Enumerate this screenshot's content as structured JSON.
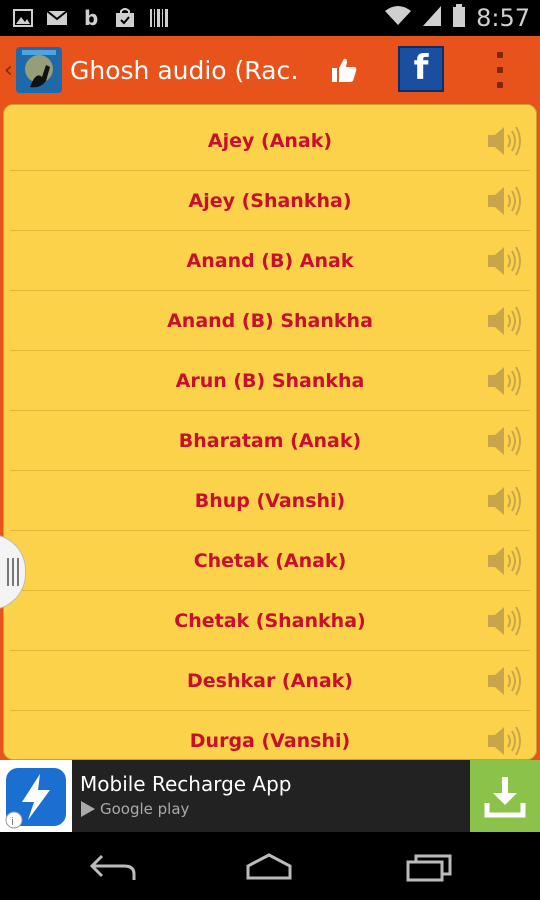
{
  "status_bar": {
    "time": "8:57",
    "left_icons": [
      "gallery-icon",
      "gmail-icon",
      "b-app-icon",
      "shopping-bag-icon",
      "barcode-icon"
    ],
    "right_icons": [
      "wifi-icon",
      "signal-icon",
      "battery-icon"
    ]
  },
  "action_bar": {
    "title": "Ghosh audio (Rac…",
    "like_icon": "thumbs-up-icon",
    "facebook_label": "f",
    "overflow_icon": "overflow-menu-icon"
  },
  "list": {
    "items": [
      {
        "label": "Ajey (Anak)"
      },
      {
        "label": "Ajey (Shankha)"
      },
      {
        "label": "Anand (B) Anak"
      },
      {
        "label": "Anand (B) Shankha"
      },
      {
        "label": "Arun (B) Shankha"
      },
      {
        "label": "Bharatam (Anak)"
      },
      {
        "label": "Bhup (Vanshi)"
      },
      {
        "label": "Chetak (Anak)"
      },
      {
        "label": "Chetak (Shankha)"
      },
      {
        "label": "Deshkar (Anak)"
      },
      {
        "label": "Durga (Vanshi)"
      }
    ],
    "item_icon": "speaker-icon"
  },
  "ad": {
    "title": "Mobile Recharge App",
    "store": "Google play",
    "download_icon": "download-icon"
  },
  "nav_bar": {
    "buttons": [
      "back-icon",
      "home-icon",
      "recents-icon"
    ]
  },
  "colors": {
    "action_bar": "#e8521b",
    "list_bg": "#fcd24a",
    "label": "#c8102e",
    "ad_download": "#8bc34a"
  }
}
